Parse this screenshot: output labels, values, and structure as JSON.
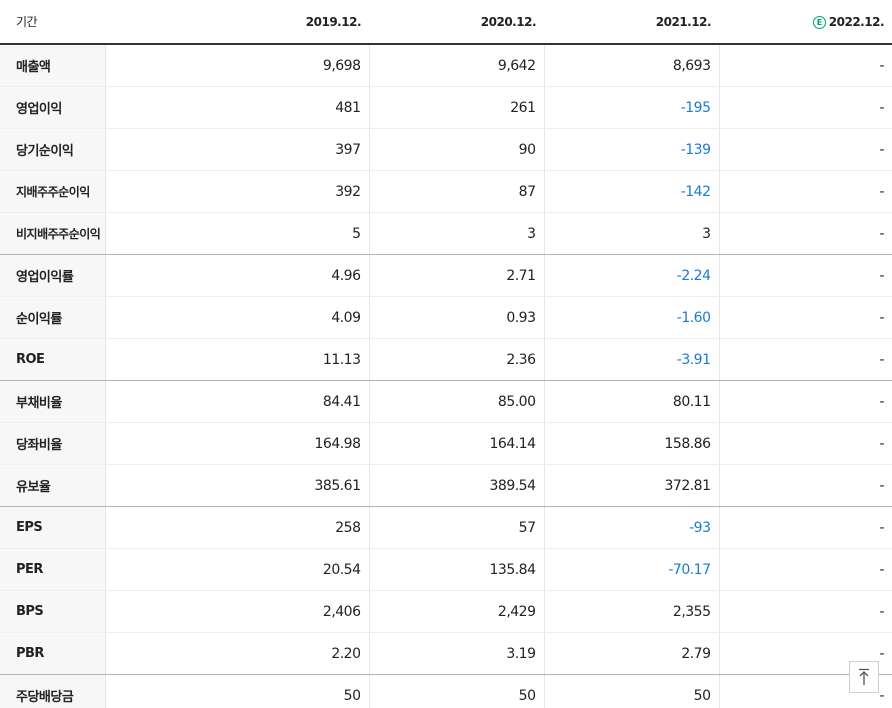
{
  "header": {
    "period_label": "기간",
    "periods": [
      "2019.12.",
      "2020.12.",
      "2021.12.",
      "2022.12."
    ],
    "estimate_badge": "E"
  },
  "rows": [
    {
      "label": "매출액",
      "values": [
        "9,698",
        "9,642",
        "8,693",
        "-"
      ],
      "negative": [
        false,
        false,
        false,
        false
      ]
    },
    {
      "label": "영업이익",
      "values": [
        "481",
        "261",
        "-195",
        "-"
      ],
      "negative": [
        false,
        false,
        true,
        false
      ]
    },
    {
      "label": "당기순이익",
      "values": [
        "397",
        "90",
        "-139",
        "-"
      ],
      "negative": [
        false,
        false,
        true,
        false
      ]
    },
    {
      "label": "지배주주순이익",
      "values": [
        "392",
        "87",
        "-142",
        "-"
      ],
      "negative": [
        false,
        false,
        true,
        false
      ]
    },
    {
      "label": "비지배주주순이익",
      "values": [
        "5",
        "3",
        "3",
        "-"
      ],
      "negative": [
        false,
        false,
        false,
        false
      ]
    },
    {
      "label": "영업이익률",
      "values": [
        "4.96",
        "2.71",
        "-2.24",
        "-"
      ],
      "negative": [
        false,
        false,
        true,
        false
      ]
    },
    {
      "label": "순이익률",
      "values": [
        "4.09",
        "0.93",
        "-1.60",
        "-"
      ],
      "negative": [
        false,
        false,
        true,
        false
      ]
    },
    {
      "label": "ROE",
      "values": [
        "11.13",
        "2.36",
        "-3.91",
        "-"
      ],
      "negative": [
        false,
        false,
        true,
        false
      ]
    },
    {
      "label": "부채비율",
      "values": [
        "84.41",
        "85.00",
        "80.11",
        "-"
      ],
      "negative": [
        false,
        false,
        false,
        false
      ]
    },
    {
      "label": "당좌비율",
      "values": [
        "164.98",
        "164.14",
        "158.86",
        "-"
      ],
      "negative": [
        false,
        false,
        false,
        false
      ]
    },
    {
      "label": "유보율",
      "values": [
        "385.61",
        "389.54",
        "372.81",
        "-"
      ],
      "negative": [
        false,
        false,
        false,
        false
      ]
    },
    {
      "label": "EPS",
      "values": [
        "258",
        "57",
        "-93",
        "-"
      ],
      "negative": [
        false,
        false,
        true,
        false
      ]
    },
    {
      "label": "PER",
      "values": [
        "20.54",
        "135.84",
        "-70.17",
        "-"
      ],
      "negative": [
        false,
        false,
        true,
        false
      ]
    },
    {
      "label": "BPS",
      "values": [
        "2,406",
        "2,429",
        "2,355",
        "-"
      ],
      "negative": [
        false,
        false,
        false,
        false
      ]
    },
    {
      "label": "PBR",
      "values": [
        "2.20",
        "3.19",
        "2.79",
        "-"
      ],
      "negative": [
        false,
        false,
        false,
        false
      ]
    },
    {
      "label": "주당배당금",
      "values": [
        "50",
        "50",
        "50",
        "-"
      ],
      "negative": [
        false,
        false,
        false,
        false
      ]
    }
  ],
  "colors": {
    "negative_text": "#1a7ad6",
    "estimate_badge": "#00a36c",
    "label_background": "#f7f7f7"
  },
  "icons": {
    "scroll_top": "arrow-up-to-line-icon"
  }
}
